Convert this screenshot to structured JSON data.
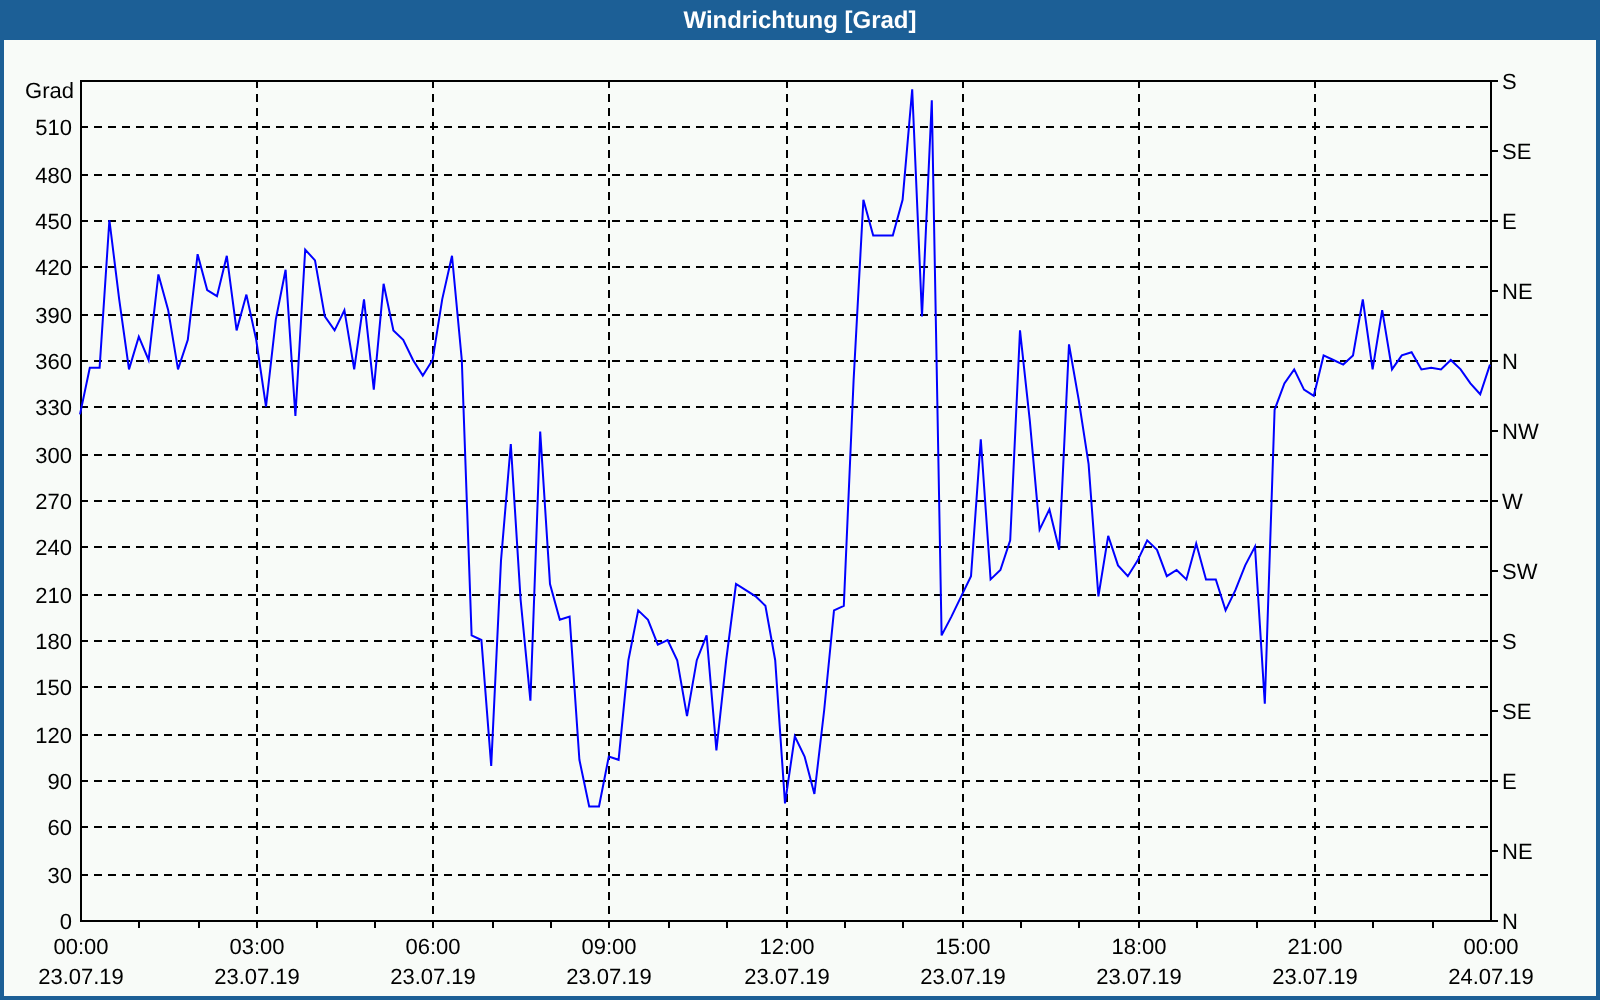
{
  "window": {
    "title": "Windrichtung [Grad]"
  },
  "chart": {
    "chart_data": {
      "type": "line",
      "grid": true,
      "ylabel": "Grad",
      "ylim": [
        0,
        540
      ],
      "yticks": [
        0,
        30,
        60,
        90,
        120,
        150,
        180,
        210,
        240,
        270,
        300,
        330,
        360,
        390,
        420,
        450,
        480,
        510
      ],
      "categories": [
        "00:00\n23.07.19",
        null,
        null,
        null,
        null,
        null,
        null,
        null,
        null,
        null,
        null,
        null,
        null,
        null,
        null,
        null,
        null,
        null,
        "03:00\n23.07.19",
        null,
        null,
        null,
        null,
        null,
        null,
        null,
        null,
        null,
        null,
        null,
        null,
        null,
        null,
        null,
        null,
        null,
        "06:00\n23.07.19",
        null,
        null,
        null,
        null,
        null,
        null,
        null,
        null,
        null,
        null,
        null,
        null,
        null,
        null,
        null,
        null,
        null,
        "09:00\n23.07.19",
        null,
        null,
        null,
        null,
        null,
        null,
        null,
        null,
        null,
        null,
        null,
        null,
        null,
        null,
        null,
        null,
        null,
        "12:00\n23.07.19",
        null,
        null,
        null,
        null,
        null,
        null,
        null,
        null,
        null,
        null,
        null,
        null,
        null,
        null,
        null,
        null,
        null,
        "15:00\n23.07.19",
        null,
        null,
        null,
        null,
        null,
        null,
        null,
        null,
        null,
        null,
        null,
        null,
        null,
        null,
        null,
        null,
        null,
        "18:00\n23.07.19",
        null,
        null,
        null,
        null,
        null,
        null,
        null,
        null,
        null,
        null,
        null,
        null,
        null,
        null,
        null,
        null,
        null,
        "21:00\n23.07.19",
        null,
        null,
        null,
        null,
        null,
        null,
        null,
        null,
        null,
        null,
        null,
        null,
        null,
        null,
        null,
        null,
        null,
        "00:00\n24.07.19"
      ],
      "series": [
        {
          "color": "#0000ff",
          "values": [
            325,
            355,
            355,
            450,
            399,
            354,
            375,
            360,
            415,
            392,
            354,
            373,
            428,
            405,
            401,
            427,
            379,
            402,
            373,
            330,
            386,
            418,
            324,
            431,
            424,
            388,
            379,
            392,
            354,
            399,
            341,
            409,
            379,
            373,
            360,
            350,
            360,
            399,
            427,
            360,
            183,
            180,
            99,
            231,
            306,
            206,
            141,
            314,
            216,
            193,
            195,
            103,
            73,
            73,
            105,
            103,
            167,
            199,
            193,
            177,
            180,
            167,
            131,
            167,
            183,
            109,
            167,
            216,
            212,
            208,
            202,
            167,
            75,
            118,
            105,
            81,
            135,
            199,
            202,
            347,
            463,
            440,
            440,
            440,
            463,
            534,
            388,
            527,
            183,
            195,
            208,
            221,
            309,
            219,
            225,
            244,
            379,
            321,
            251,
            264,
            238,
            370,
            334,
            293,
            208,
            247,
            228,
            221,
            231,
            244,
            238,
            221,
            225,
            219,
            242,
            219,
            219,
            199,
            212,
            228,
            240,
            139,
            328,
            345,
            354,
            341,
            337,
            363,
            360,
            357,
            363,
            399,
            354,
            392,
            354,
            363,
            365,
            354,
            355,
            354,
            360,
            354,
            345,
            338,
            357
          ]
        }
      ]
    },
    "right_axis": {
      "labels": [
        "S",
        "SE",
        "E",
        "NE",
        "N",
        "NW",
        "W",
        "SW",
        "S",
        "SE",
        "E",
        "NE",
        "N"
      ]
    }
  }
}
